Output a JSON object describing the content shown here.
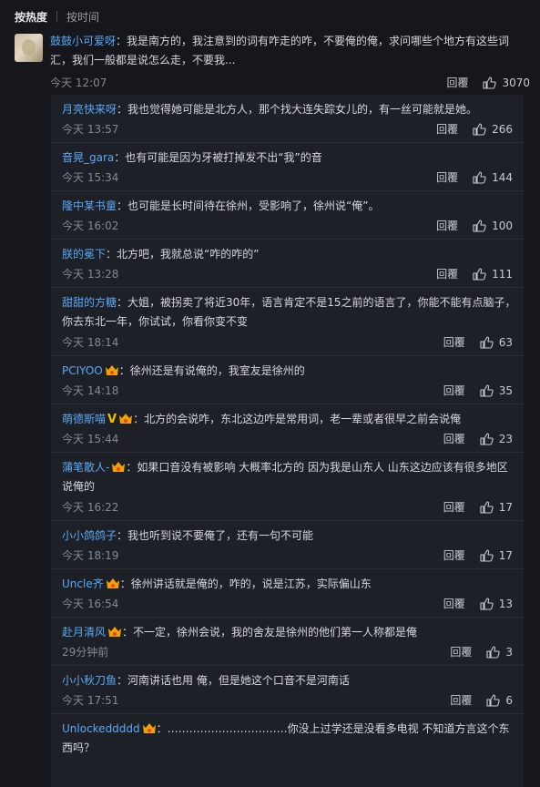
{
  "sort": {
    "hot": "按热度",
    "time": "按时间"
  },
  "main_comment": {
    "user": "鼓鼓小可爱呀",
    "text": "：我是南方的，我注意到的词有咋走的咋，不要俺的俺，求问哪些个地方有这些词汇，我们一般都是说怎么走，不要我...",
    "time": "今天 12:07",
    "reply_label": "回覆",
    "likes": "3070"
  },
  "replies": [
    {
      "user": "月亮快来呀",
      "text": "：我也觉得她可能是北方人，那个找大连失踪女儿的，有一丝可能就是她。",
      "time": "今天 13:57",
      "reply_label": "回覆",
      "likes": "266"
    },
    {
      "user": "音晃_gara",
      "text": "：也有可能是因为牙被打掉发不出“我”的音",
      "time": "今天 15:34",
      "reply_label": "回覆",
      "likes": "144"
    },
    {
      "user": "隆中某书童",
      "text": "：也可能是长时间待在徐州，受影响了，徐州说“俺”。",
      "time": "今天 16:02",
      "reply_label": "回覆",
      "likes": "100"
    },
    {
      "user": "朕的冕下",
      "text": "：北方吧，我就总说“咋的咋的”",
      "time": "今天 13:28",
      "reply_label": "回覆",
      "likes": "111"
    },
    {
      "user": "甜甜的方糖",
      "text": "：大姐，被拐卖了将近30年，语言肯定不是15之前的语言了，你能不能有点脑子，你去东北一年，你试试，你看你变不变",
      "time": "今天 18:14",
      "reply_label": "回覆",
      "likes": "63"
    },
    {
      "user": "PCIYOO",
      "text": "：徐州还是有说俺的，我室友是徐州的",
      "time": "今天 14:18",
      "reply_label": "回覆",
      "likes": "35"
    },
    {
      "user": "萌德斯喵",
      "vip": "V",
      "text": "：北方的会说咋，东北这边咋是常用词，老一辈或者很早之前会说俺",
      "time": "今天 15:44",
      "reply_label": "回覆",
      "likes": "23"
    },
    {
      "user": "蒲笔散人-",
      "text": "：如果口音没有被影响 大概率北方的 因为我是山东人 山东这边应该有很多地区说俺的",
      "time": "今天 16:22",
      "reply_label": "回覆",
      "likes": "17"
    },
    {
      "user": "小小鸽鸽子",
      "text": "：我也听到说不要俺了，还有一句不可能",
      "time": "今天 18:19",
      "reply_label": "回覆",
      "likes": "17"
    },
    {
      "user": "Uncle齐",
      "text": "：徐州讲话就是俺的，咋的，说是江苏，实际偏山东",
      "time": "今天 16:54",
      "reply_label": "回覆",
      "likes": "13"
    },
    {
      "user": "赴月清风",
      "text": "：不一定，徐州会说，我的舍友是徐州的他们第一人称都是俺",
      "time": "29分钟前",
      "reply_label": "回覆",
      "likes": "3"
    },
    {
      "user": "小小秋刀鱼",
      "text": "：河南讲话也用 俺，但是她这个口音不是河南话",
      "time": "今天 17:51",
      "reply_label": "回覆",
      "likes": "6"
    },
    {
      "user": "Unlockeddddd",
      "text": "：……………………………你没上过学还是没看多电视 不知道方言这个东西吗？",
      "time": "",
      "reply_label": "",
      "likes": ""
    }
  ],
  "colors": {
    "background": "#16171c",
    "username": "#5aa9f5",
    "reply_bg": "#1e2028",
    "vip": "#f2c200"
  }
}
